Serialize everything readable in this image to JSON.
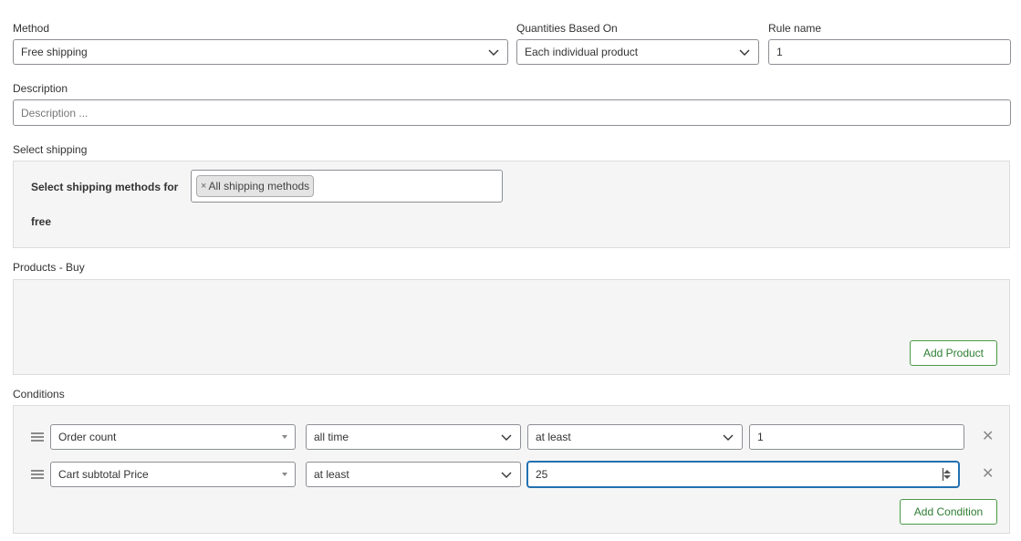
{
  "method": {
    "label": "Method",
    "value": "Free shipping"
  },
  "quantities": {
    "label": "Quantities Based On",
    "value": "Each individual product"
  },
  "rule_name": {
    "label": "Rule name",
    "value": "1"
  },
  "description": {
    "label": "Description",
    "placeholder": "Description ..."
  },
  "select_shipping": {
    "label": "Select shipping",
    "for_label_line1": "Select shipping methods for",
    "for_label_line2": "free",
    "tag_remove": "×",
    "tag": "All shipping methods"
  },
  "products_buy": {
    "label": "Products - Buy",
    "add_button": "Add Product"
  },
  "conditions": {
    "label": "Conditions",
    "remove_symbol": "✕",
    "rows": [
      {
        "type": "Order count",
        "period": "all time",
        "operator": "at least",
        "value": "1"
      },
      {
        "type": "Cart subtotal Price",
        "operator": "at least",
        "value": "25"
      }
    ],
    "add_button": "Add Condition"
  },
  "colors": {
    "accent_green": "#2e7d32",
    "focus_border": "#2271b1",
    "panel_bg": "#f5f5f5"
  },
  "icons": [
    "chevron-down-icon",
    "drag-handle-icon",
    "close-icon",
    "spinner-arrows-icon"
  ]
}
